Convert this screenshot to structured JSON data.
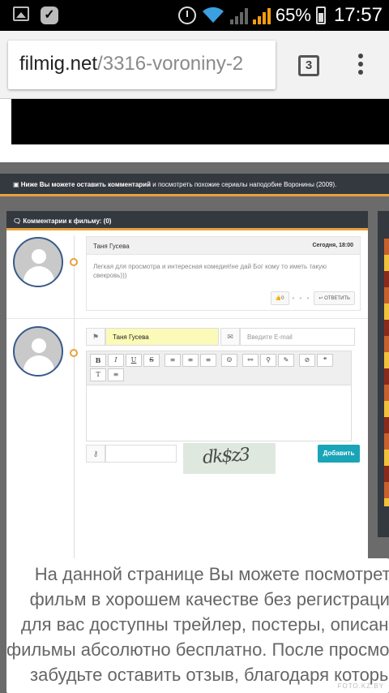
{
  "status_bar": {
    "battery_percent": "65%",
    "time": "17:57"
  },
  "browser": {
    "url_domain": "filmig.net",
    "url_path": "/3316-voroniny-2",
    "tab_count": "3"
  },
  "page": {
    "info_bar": {
      "bold_text": "Ниже Вы можете оставить комментарий",
      "rest_text": " и посмотреть похожие сериалы наподобие Воронины (2009)."
    },
    "comments": {
      "header": "Комментарии к фильму: (0)",
      "items": [
        {
          "author": "Таня Гусева",
          "date": "Сегодня, 18:00",
          "text": "Легкая для просмотра и интересная комедия!не дай Бог кому то иметь такую свекровь)))",
          "likes": "0",
          "reply_label": "ОТВЕТИТЬ"
        }
      ]
    },
    "form": {
      "name_value": "Таня Гусева",
      "email_placeholder": "Введите E-mail",
      "toolbar_row1": [
        "B",
        "I",
        "U",
        "S",
        "≡",
        "≡",
        "≡",
        "☺",
        "⚯",
        "⚲",
        "✎",
        "⊘",
        "❝"
      ],
      "toolbar_row2": [
        "T",
        "≡"
      ],
      "captcha_text": "dk$z3",
      "submit_label": "Добавить"
    },
    "popup": {
      "lines": [
        "На данной странице Вы можете посмотреть",
        "фильм в хорошем качестве без регистрации,",
        "для вас доступны трейлер, постеры, описание,",
        "фильмы абсолютно бесплатно. После просмотра не",
        "забудьте оставить отзыв, благодаря которым"
      ]
    },
    "watermark": "FOTO.KZ.BY"
  }
}
